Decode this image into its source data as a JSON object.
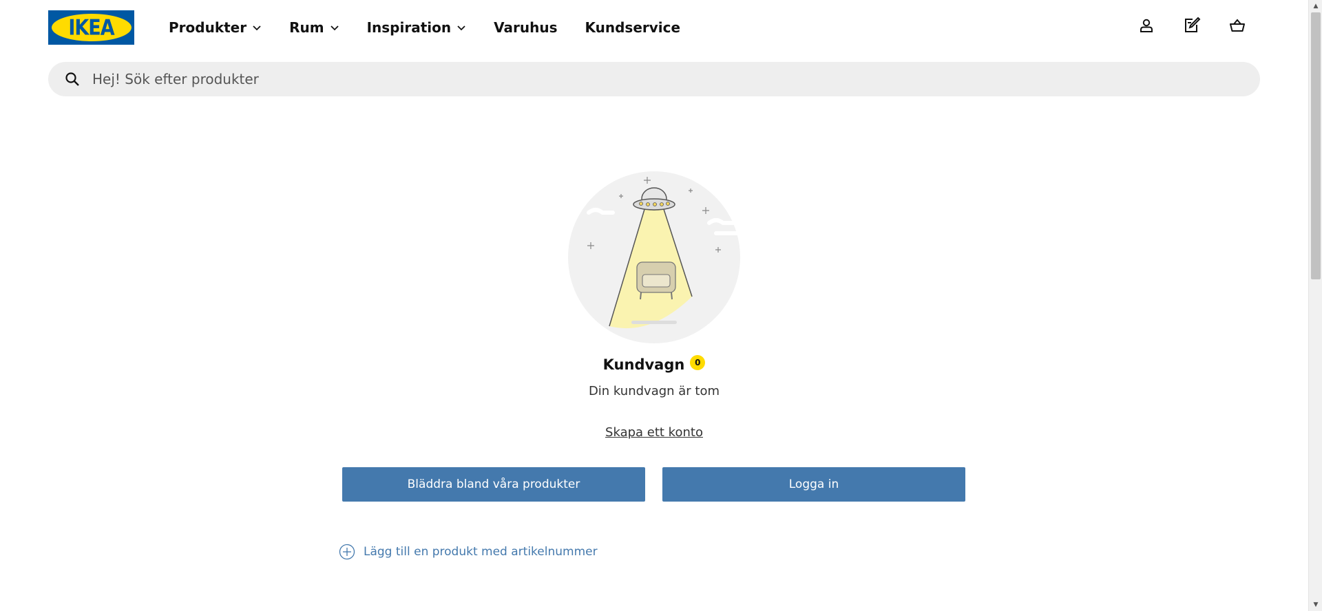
{
  "brand": {
    "logo_text": "IKEA",
    "colors": {
      "blue": "#0058a3",
      "yellow": "#ffdb00",
      "button": "#4479ad"
    }
  },
  "nav": {
    "items": [
      {
        "label": "Produkter",
        "has_dropdown": true
      },
      {
        "label": "Rum",
        "has_dropdown": true
      },
      {
        "label": "Inspiration",
        "has_dropdown": true
      },
      {
        "label": "Varuhus",
        "has_dropdown": false
      },
      {
        "label": "Kundservice",
        "has_dropdown": false
      }
    ]
  },
  "header_icons": [
    "user-icon",
    "shopping-list-icon",
    "cart-icon"
  ],
  "search": {
    "placeholder": "Hej! Sök efter produkter",
    "icon": "search-icon"
  },
  "cart": {
    "title": "Kundvagn",
    "count": "0",
    "empty_message": "Din kundvagn är tom",
    "create_account_link": "Skapa ett konto",
    "browse_button": "Bläddra bland våra produkter",
    "login_button": "Logga in",
    "add_by_article": "Lägg till en produkt med artikelnummer"
  }
}
